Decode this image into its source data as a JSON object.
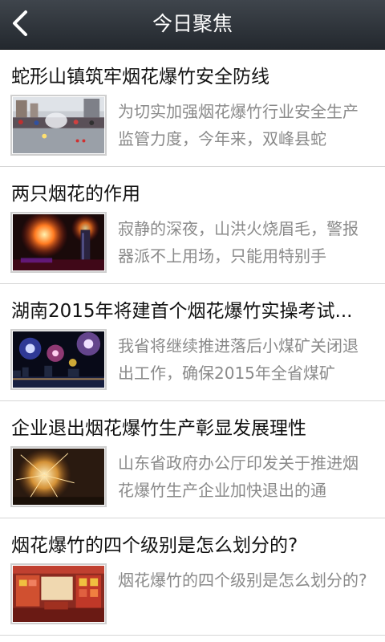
{
  "header": {
    "title": "今日聚焦",
    "back_icon": "chevron-left-icon"
  },
  "colors": {
    "header_bg": "#2b3036",
    "title_text": "#111111",
    "summary_text": "#8a8a8a",
    "divider": "#d6d6d6"
  },
  "articles": [
    {
      "title": "蛇形山镇筑牢烟花爆竹安全防线",
      "summary": "为切实加强烟花爆竹行业安全生产监管力度，今年来，双峰县蛇",
      "thumb_icon": "street-fireworks-photo"
    },
    {
      "title": "两只烟花的作用",
      "summary": "寂静的深夜，山洪火烧眉毛，警报器派不上用场，只能用特别手",
      "thumb_icon": "night-fireworks-building-photo"
    },
    {
      "title": "湖南2015年将建首个烟花爆竹实操考试...",
      "summary": "我省将继续推进落后小煤矿关闭退出工作，确保2015年全省煤矿",
      "thumb_icon": "skyline-fireworks-photo"
    },
    {
      "title": "企业退出烟花爆竹生产彰显发展理性",
      "summary": "山东省政府办公厅印发关于推进烟花爆竹生产企业加快退出的通",
      "thumb_icon": "sparkler-burst-photo"
    },
    {
      "title": "烟花爆竹的四个级别是怎么划分的?",
      "summary": "烟花爆竹的四个级别是怎么划分的?",
      "thumb_icon": "fireworks-shop-photo"
    }
  ]
}
